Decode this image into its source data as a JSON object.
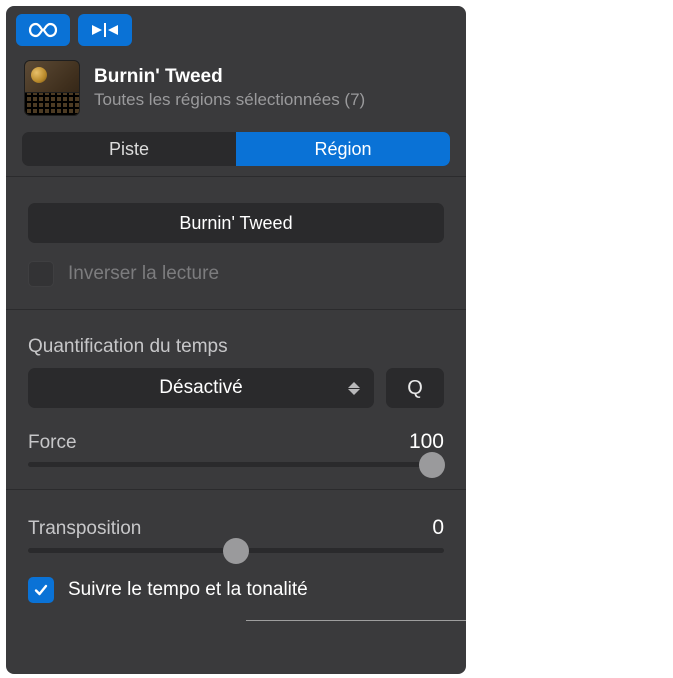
{
  "header": {
    "title": "Burnin' Tweed",
    "subtitle": "Toutes les régions sélectionnées (7)"
  },
  "tabs": {
    "track": "Piste",
    "region": "Région"
  },
  "region": {
    "name_value": "Burnin' Tweed",
    "reverse_label": "Inverser la lecture"
  },
  "quantize": {
    "label": "Quantification du temps",
    "value": "Désactivé",
    "q_button": "Q",
    "force_label": "Force",
    "force_value": "100"
  },
  "transpose": {
    "label": "Transposition",
    "value": "0"
  },
  "follow": {
    "label": "Suivre le tempo et la tonalité"
  }
}
